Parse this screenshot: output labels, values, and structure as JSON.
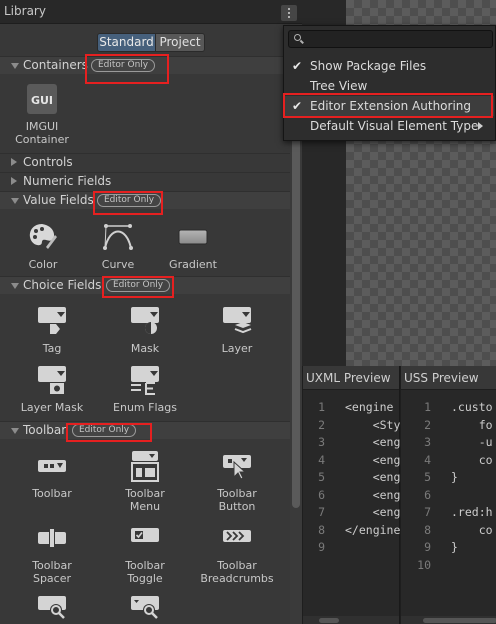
{
  "library": {
    "title": "Library",
    "tabs": {
      "standard": "Standard",
      "project": "Project"
    },
    "categories": {
      "containers": {
        "label": "Containers",
        "badge": "Editor Only"
      },
      "controls": {
        "label": "Controls"
      },
      "numeric": {
        "label": "Numeric Fields"
      },
      "value": {
        "label": "Value Fields",
        "badge": "Editor Only"
      },
      "choice": {
        "label": "Choice Fields",
        "badge": "Editor Only"
      },
      "toolbar": {
        "label": "Toolbar",
        "badge": "Editor Only"
      }
    },
    "items": {
      "imgui": {
        "label_line1": "IMGUI",
        "label_line2": "Container",
        "icon_text": "GUI"
      },
      "color": {
        "label": "Color"
      },
      "curve": {
        "label": "Curve"
      },
      "gradient": {
        "label": "Gradient"
      },
      "tag": {
        "label": "Tag"
      },
      "mask": {
        "label": "Mask"
      },
      "layer": {
        "label": "Layer"
      },
      "layer_mask": {
        "label": "Layer Mask"
      },
      "enum_flags": {
        "label": "Enum Flags"
      },
      "toolbar": {
        "label": "Toolbar"
      },
      "toolbar_menu": {
        "label_line1": "Toolbar",
        "label_line2": "Menu"
      },
      "toolbar_button": {
        "label_line1": "Toolbar",
        "label_line2": "Button"
      },
      "toolbar_spacer": {
        "label_line1": "Toolbar",
        "label_line2": "Spacer"
      },
      "toolbar_toggle": {
        "label_line1": "Toolbar",
        "label_line2": "Toggle"
      },
      "toolbar_breadcrumbs": {
        "label_line1": "Toolbar",
        "label_line2": "Breadcrumbs"
      }
    }
  },
  "menu": {
    "search_value": "",
    "check_glyph": "✔",
    "items": [
      {
        "label": "Show Package Files",
        "checked": true
      },
      {
        "label": "Tree View",
        "checked": false
      },
      {
        "label": "Editor Extension Authoring",
        "checked": true
      },
      {
        "label": "Default Visual Element Type",
        "submenu": true
      }
    ]
  },
  "uxml_preview": {
    "title": "UXML Preview",
    "line_numbers": [
      "1",
      "2",
      "3",
      "4",
      "5",
      "6",
      "7",
      "8",
      "9"
    ],
    "lines": [
      "<engine",
      "    <Sty",
      "    <eng",
      "    <eng",
      "    <eng",
      "    <eng",
      "    <eng",
      "</engine",
      ""
    ]
  },
  "uss_preview": {
    "title": "USS Preview",
    "line_numbers": [
      "1",
      "2",
      "3",
      "4",
      "5",
      "6",
      "7",
      "8",
      "9",
      "10"
    ],
    "lines": [
      ".custo",
      "    fo",
      "    -u",
      "    co",
      "}",
      "",
      ".red:h",
      "    co",
      "}",
      ""
    ]
  },
  "colors": {
    "highlight_box": "#e62020",
    "selected_tab": "#46607c",
    "panel_bg": "#383838"
  }
}
